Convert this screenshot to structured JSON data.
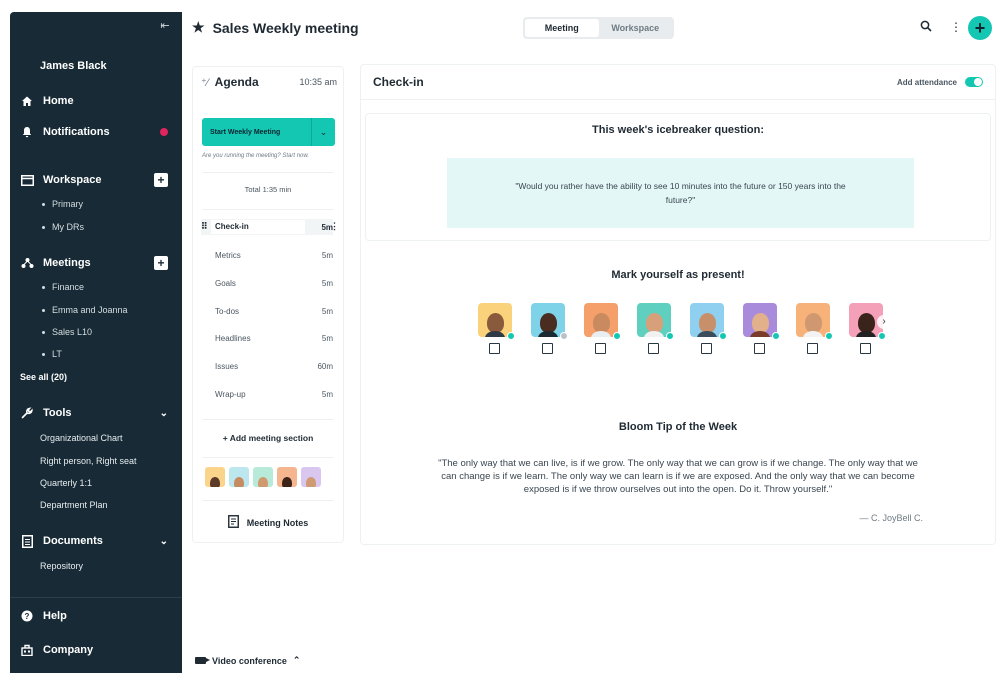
{
  "sidebar": {
    "user_name": "James Black",
    "home": "Home",
    "notifications": "Notifications",
    "workspace": {
      "label": "Workspace",
      "items": [
        "Primary",
        "My DRs"
      ]
    },
    "meetings": {
      "label": "Meetings",
      "items": [
        "Finance",
        "Emma and Joanna",
        "Sales L10",
        "LT"
      ],
      "see_all": "See all (20)"
    },
    "tools": {
      "label": "Tools",
      "items": [
        "Organizational Chart",
        "Right person, Right seat",
        "Quarterly 1:1",
        "Department Plan"
      ]
    },
    "documents": {
      "label": "Documents",
      "items": [
        "Repository"
      ]
    },
    "help": "Help",
    "company": "Company"
  },
  "header": {
    "title": "Sales Weekly meeting",
    "tabs": [
      "Meeting",
      "Workspace"
    ],
    "active_tab": "Meeting"
  },
  "agenda": {
    "title": "Agenda",
    "time": "10:35 am",
    "start_button": "Start Weekly Meeting",
    "start_hint": "Are you running the meeting? Start now.",
    "total": "Total 1:35 min",
    "sections": [
      {
        "name": "Check-in",
        "duration": "5m"
      },
      {
        "name": "Metrics",
        "duration": "5m"
      },
      {
        "name": "Goals",
        "duration": "5m"
      },
      {
        "name": "To-dos",
        "duration": "5m"
      },
      {
        "name": "Headlines",
        "duration": "5m"
      },
      {
        "name": "Issues",
        "duration": "60m"
      },
      {
        "name": "Wrap-up",
        "duration": "5m"
      }
    ],
    "add_section": "+ Add meeting section",
    "notes_button": "Meeting Notes"
  },
  "checkin": {
    "title": "Check-in",
    "attendance_label": "Add attendance",
    "attendance_on": true,
    "icebreaker_title": "This week's icebreaker question:",
    "icebreaker_question": "\"Would you rather have the ability to see 10 minutes into the future or 150 years into the future?\"",
    "present_title": "Mark yourself as present!",
    "tip_title": "Bloom Tip of the Week",
    "tip_text": "\"The only way that we can live, is if we grow. The only way that we can grow is if we change. The only way that we can change is if we learn. The only way we can learn is if we are exposed. And the only way that we can become exposed is if we throw ourselves out into the open. Do it. Throw yourself.\"",
    "tip_author": "— C. JoyBell C."
  },
  "colors": {
    "sidebar_bg": "#172a35",
    "accent": "#14c7b2",
    "icebreaker_bg": "#e3f7f6",
    "notification_dot": "#e0245e"
  },
  "footer": {
    "video": "Video conference"
  }
}
